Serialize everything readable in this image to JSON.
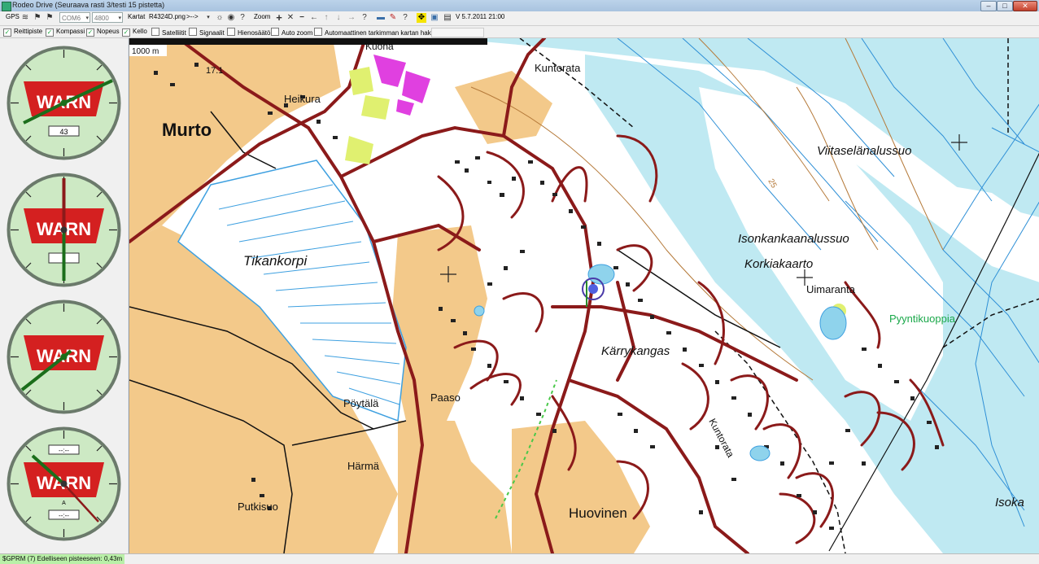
{
  "window": {
    "title": "Rodeo Drive (Seuraava rasti 3/testi 15 pistetta)",
    "minimize": "–",
    "maximize": "□",
    "close": "✕"
  },
  "toolbar": {
    "gps_label": "GPS",
    "port_value": "COM6",
    "baud_value": "4800",
    "maps_label": "Kartat",
    "map_file": "R4324D.png",
    "arrow_label": ">-->",
    "zoom_label": "Zoom",
    "version": "V 5.7.2011 21:00"
  },
  "options": [
    {
      "label": "Reittipiste",
      "checked": true
    },
    {
      "label": "Kompassi",
      "checked": true
    },
    {
      "label": "Nopeus",
      "checked": true
    },
    {
      "label": "Kello",
      "checked": true
    },
    {
      "label": "Satelliitit",
      "checked": false
    },
    {
      "label": "Signaalit",
      "checked": false
    },
    {
      "label": "Hienosäätö",
      "checked": false
    },
    {
      "label": "Auto zoom",
      "checked": false
    },
    {
      "label": "Automaattinen tarkimman kartan haku",
      "checked": false
    }
  ],
  "gauges": {
    "logo_text": "WARN",
    "g1_value": "43",
    "g4_upper": "--:--",
    "g4_lower": "--:--",
    "g4_mark": "A"
  },
  "map": {
    "scale_label": "1000 m",
    "contour_label": "25",
    "places": {
      "murto": "Murto",
      "heikura": "Heikura",
      "kuona": "Kuona",
      "kuntorata_n": "Kuntorata",
      "viitaselanalussuo": "Viitaselänalussuo",
      "isonkankaanalussuo": "Isonkankaanalussuo",
      "korkiakaarto": "Korkiakaarto",
      "uimaranta": "Uimaranta",
      "pyyntikuoppia": "Pyyntikuoppia",
      "tikankorpi": "Tikankorpi",
      "karrykangas": "Kärrykangas",
      "poytala": "Pöytälä",
      "paaso": "Paaso",
      "harma": "Härmä",
      "putkisuo": "Putkisuo",
      "huovinen": "Huovinen",
      "kuntorata_s": "Kuntorata",
      "isoka": "Isoka",
      "num": "17.1"
    }
  },
  "status": {
    "text": "$GPRM (7) Edelliseen pisteeseen: 0,43m"
  },
  "colors": {
    "road": "#8b1a1a",
    "field": "#f3c98a",
    "water": "#bfe9f2",
    "marsh_line": "#2e8fd6",
    "status_bg": "#b9f0a8",
    "warn_red": "#d42020",
    "gauge_green": "#cde9c4"
  }
}
